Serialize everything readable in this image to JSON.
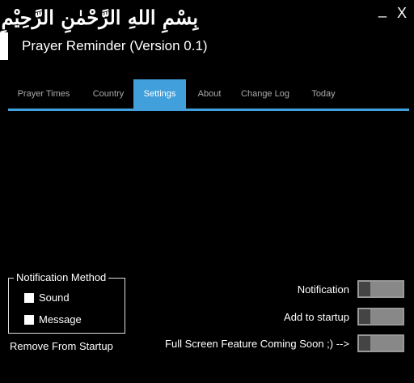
{
  "header": {
    "bismillah": "بِسْمِ اللهِ الرَّحْمٰنِ الرَّحِيْمِ",
    "app_title": "Prayer Reminder (Version 0.1)",
    "minimize_label": "_",
    "close_label": "X"
  },
  "tabs": [
    {
      "label": "Prayer Times",
      "active": false
    },
    {
      "label": "Country",
      "active": false
    },
    {
      "label": "Settings",
      "active": true
    },
    {
      "label": "About",
      "active": false
    },
    {
      "label": "Change Log",
      "active": false
    },
    {
      "label": "Today",
      "active": false
    }
  ],
  "settings": {
    "notification_method": {
      "legend": "Notification Method",
      "options": [
        {
          "label": "Sound",
          "checked": false
        },
        {
          "label": "Message",
          "checked": false
        }
      ]
    },
    "remove_from_startup": "Remove From Startup",
    "toggles": [
      {
        "label": "Notification",
        "on": false
      },
      {
        "label": "Add to startup",
        "on": false
      },
      {
        "label": "Full Screen Feature Coming Soon ;) -->",
        "on": false
      }
    ]
  },
  "colors": {
    "background": "#000000",
    "accent": "#41a0db",
    "toggle_track": "#888888",
    "toggle_knob": "#444444"
  }
}
